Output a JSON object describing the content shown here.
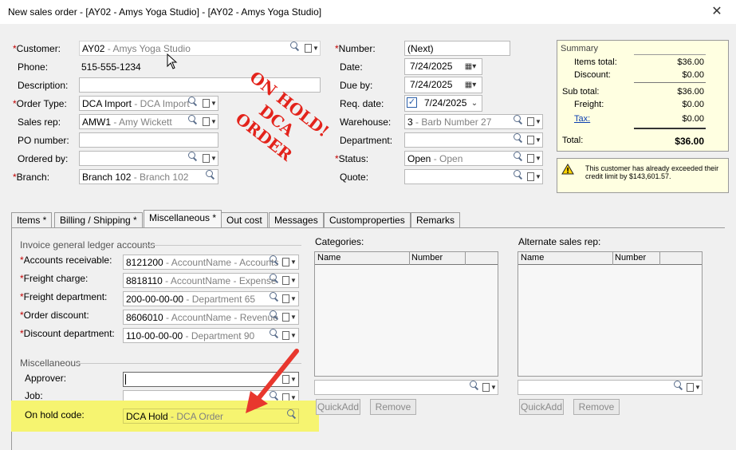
{
  "window": {
    "title": "New sales order - [AY02 - Amys Yoga Studio] - [AY02 - Amys Yoga Studio]",
    "close_glyph": "✕"
  },
  "header_left": {
    "customer": {
      "label": "Customer:",
      "code": "AY02",
      "desc": " - Amys Yoga Studio"
    },
    "phone": {
      "label": "Phone:",
      "value": "515-555-1234"
    },
    "description": {
      "label": "Description:",
      "value": ""
    },
    "order_type": {
      "label": "Order Type:",
      "code": "DCA Import",
      "desc": " - DCA Import"
    },
    "sales_rep": {
      "label": "Sales rep:",
      "code": "AMW1",
      "desc": " - Amy Wickett"
    },
    "po_number": {
      "label": "PO number:",
      "value": ""
    },
    "ordered_by": {
      "label": "Ordered by:",
      "value": ""
    },
    "branch": {
      "label": "Branch:",
      "code": "Branch 102",
      "desc": " - Branch 102"
    }
  },
  "stamp": {
    "line1": "ON HOLD!",
    "line2": "DCA",
    "line3": "ORDER"
  },
  "header_mid": {
    "number": {
      "label": "Number:",
      "value": "(Next)"
    },
    "date": {
      "label": "Date:",
      "value": "7/24/2025"
    },
    "due_by": {
      "label": "Due by:",
      "value": "7/24/2025"
    },
    "req_date": {
      "label": "Req. date:",
      "value": "7/24/2025"
    },
    "warehouse": {
      "label": "Warehouse:",
      "code": "3",
      "desc": " - Barb Number 27"
    },
    "department": {
      "label": "Department:",
      "value": ""
    },
    "status": {
      "label": "Status:",
      "code": "Open",
      "desc": " - Open"
    },
    "quote": {
      "label": "Quote:",
      "value": ""
    }
  },
  "summary": {
    "title": "Summary",
    "items_total": {
      "label": "Items total:",
      "value": "$36.00"
    },
    "discount": {
      "label": "Discount:",
      "value": "$0.00"
    },
    "sub_total": {
      "label": "Sub total:",
      "value": "$36.00"
    },
    "freight": {
      "label": "Freight:",
      "value": "$0.00"
    },
    "tax": {
      "label": "Tax:",
      "value": "$0.00"
    },
    "total": {
      "label": "Total:",
      "value": "$36.00"
    }
  },
  "warning": {
    "text": "This customer has already exceeded their credit limit by $143,601.57."
  },
  "tabs": [
    {
      "label": "Items *"
    },
    {
      "label": "Billing / Shipping *"
    },
    {
      "label": "Miscellaneous *"
    },
    {
      "label": "Out cost"
    },
    {
      "label": "Messages"
    },
    {
      "label": "Customproperties"
    },
    {
      "label": "Remarks"
    }
  ],
  "misc": {
    "gl_group": "Invoice general ledger accounts",
    "accounts_receivable": {
      "label": "Accounts receivable:",
      "code": "8121200",
      "desc": " - AccountName - Accounts R"
    },
    "freight_charge": {
      "label": "Freight charge:",
      "code": "8818110",
      "desc": " - AccountName - Expense"
    },
    "freight_department": {
      "label": "Freight department:",
      "code": "200-00-00-00",
      "desc": " - Department 65"
    },
    "order_discount": {
      "label": "Order discount:",
      "code": "8606010",
      "desc": " - AccountName - Revenue"
    },
    "discount_department": {
      "label": "Discount department:",
      "code": "110-00-00-00",
      "desc": " - Department 90"
    },
    "misc_group": "Miscellaneous",
    "approver": {
      "label": "Approver:",
      "value": ""
    },
    "job": {
      "label": "Job:",
      "value": ""
    },
    "on_hold_code": {
      "label": "On hold code:",
      "code": "DCA Hold",
      "desc": " - DCA Order"
    }
  },
  "categories": {
    "label": "Categories:",
    "col_name": "Name",
    "col_number": "Number",
    "quickadd": "QuickAdd",
    "remove": "Remove"
  },
  "alt_sales_rep": {
    "label": "Alternate sales rep:",
    "col_name": "Name",
    "col_number": "Number",
    "quickadd": "QuickAdd",
    "remove": "Remove"
  },
  "colors": {
    "highlight": "#f6f470",
    "stamp": "#e3231b",
    "arrow": "#e8372e",
    "required": "#c00000"
  }
}
